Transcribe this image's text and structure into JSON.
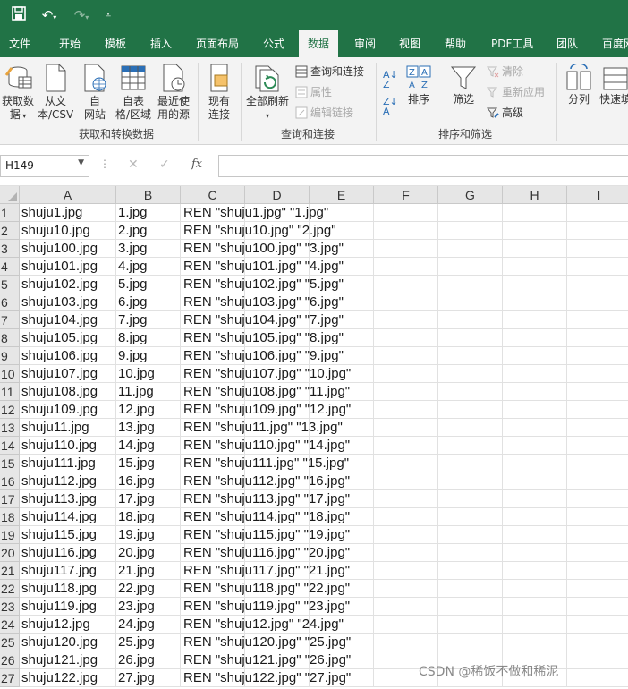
{
  "quick_access": {
    "save_icon": "save-icon",
    "undo_icon": "undo-icon",
    "redo_icon": "redo-icon",
    "customize_icon": "customize-icon"
  },
  "tabs": [
    "文件",
    "开始",
    "模板",
    "插入",
    "页面布局",
    "公式",
    "数据",
    "审阅",
    "视图",
    "帮助",
    "PDF工具",
    "团队",
    "百度网"
  ],
  "active_tab": "数据",
  "ribbon": {
    "get_data": "获取数\n据",
    "from_text_csv": "从文\n本/CSV",
    "from_web": "自\n网站",
    "from_table": "自表\n格/区域",
    "recent_sources": "最近使\n用的源",
    "existing_connections": "现有\n连接",
    "refresh_all": "全部刷新",
    "queries_connections": "查询和连接",
    "properties": "属性",
    "edit_links": "编辑链接",
    "sort": "排序",
    "filter": "筛选",
    "clear": "清除",
    "reapply": "重新应用",
    "advanced": "高级",
    "text_to_columns": "分列",
    "flash_fill": "快速填",
    "group_get_transform": "获取和转换数据",
    "group_queries": "查询和连接",
    "group_sort_filter": "排序和筛选"
  },
  "formula_bar": {
    "name_box": "H149",
    "cancel": "✕",
    "enter": "✓",
    "fx": "fx",
    "value": ""
  },
  "columns": [
    "A",
    "B",
    "C",
    "D",
    "E",
    "F",
    "G",
    "H",
    "I"
  ],
  "rows": [
    {
      "n": "1",
      "a": "shuju1.jpg",
      "b": "1.jpg",
      "c": "REN \"shuju1.jpg\" \"1.jpg\""
    },
    {
      "n": "2",
      "a": "shuju10.jpg",
      "b": "2.jpg",
      "c": "REN \"shuju10.jpg\" \"2.jpg\""
    },
    {
      "n": "3",
      "a": "shuju100.jpg",
      "b": "3.jpg",
      "c": "REN \"shuju100.jpg\" \"3.jpg\""
    },
    {
      "n": "4",
      "a": "shuju101.jpg",
      "b": "4.jpg",
      "c": "REN \"shuju101.jpg\" \"4.jpg\""
    },
    {
      "n": "5",
      "a": "shuju102.jpg",
      "b": "5.jpg",
      "c": "REN \"shuju102.jpg\" \"5.jpg\""
    },
    {
      "n": "6",
      "a": "shuju103.jpg",
      "b": "6.jpg",
      "c": "REN \"shuju103.jpg\" \"6.jpg\""
    },
    {
      "n": "7",
      "a": "shuju104.jpg",
      "b": "7.jpg",
      "c": "REN \"shuju104.jpg\" \"7.jpg\""
    },
    {
      "n": "8",
      "a": "shuju105.jpg",
      "b": "8.jpg",
      "c": "REN \"shuju105.jpg\" \"8.jpg\""
    },
    {
      "n": "9",
      "a": "shuju106.jpg",
      "b": "9.jpg",
      "c": "REN \"shuju106.jpg\" \"9.jpg\""
    },
    {
      "n": "10",
      "a": "shuju107.jpg",
      "b": "10.jpg",
      "c": "REN \"shuju107.jpg\" \"10.jpg\""
    },
    {
      "n": "11",
      "a": "shuju108.jpg",
      "b": "11.jpg",
      "c": "REN \"shuju108.jpg\" \"11.jpg\""
    },
    {
      "n": "12",
      "a": "shuju109.jpg",
      "b": "12.jpg",
      "c": "REN \"shuju109.jpg\" \"12.jpg\""
    },
    {
      "n": "13",
      "a": "shuju11.jpg",
      "b": "13.jpg",
      "c": "REN \"shuju11.jpg\" \"13.jpg\""
    },
    {
      "n": "14",
      "a": "shuju110.jpg",
      "b": "14.jpg",
      "c": "REN \"shuju110.jpg\" \"14.jpg\""
    },
    {
      "n": "15",
      "a": "shuju111.jpg",
      "b": "15.jpg",
      "c": "REN \"shuju111.jpg\" \"15.jpg\""
    },
    {
      "n": "16",
      "a": "shuju112.jpg",
      "b": "16.jpg",
      "c": "REN \"shuju112.jpg\" \"16.jpg\""
    },
    {
      "n": "17",
      "a": "shuju113.jpg",
      "b": "17.jpg",
      "c": "REN \"shuju113.jpg\" \"17.jpg\""
    },
    {
      "n": "18",
      "a": "shuju114.jpg",
      "b": "18.jpg",
      "c": "REN \"shuju114.jpg\" \"18.jpg\""
    },
    {
      "n": "19",
      "a": "shuju115.jpg",
      "b": "19.jpg",
      "c": "REN \"shuju115.jpg\" \"19.jpg\""
    },
    {
      "n": "20",
      "a": "shuju116.jpg",
      "b": "20.jpg",
      "c": "REN \"shuju116.jpg\" \"20.jpg\""
    },
    {
      "n": "21",
      "a": "shuju117.jpg",
      "b": "21.jpg",
      "c": "REN \"shuju117.jpg\" \"21.jpg\""
    },
    {
      "n": "22",
      "a": "shuju118.jpg",
      "b": "22.jpg",
      "c": "REN \"shuju118.jpg\" \"22.jpg\""
    },
    {
      "n": "23",
      "a": "shuju119.jpg",
      "b": "23.jpg",
      "c": "REN \"shuju119.jpg\" \"23.jpg\""
    },
    {
      "n": "24",
      "a": "shuju12.jpg",
      "b": "24.jpg",
      "c": "REN \"shuju12.jpg\" \"24.jpg\""
    },
    {
      "n": "25",
      "a": "shuju120.jpg",
      "b": "25.jpg",
      "c": "REN \"shuju120.jpg\" \"25.jpg\""
    },
    {
      "n": "26",
      "a": "shuju121.jpg",
      "b": "26.jpg",
      "c": "REN \"shuju121.jpg\" \"26.jpg\""
    },
    {
      "n": "27",
      "a": "shuju122.jpg",
      "b": "27.jpg",
      "c": "REN \"shuju122.jpg\" \"27.jpg\""
    }
  ],
  "watermark": "CSDN @稀饭不做和稀泥",
  "colors": {
    "excel_green": "#217346",
    "ribbon_bg": "#f3f3f3",
    "header_bg": "#e6e6e6",
    "grid_line": "#e1e1e1"
  }
}
